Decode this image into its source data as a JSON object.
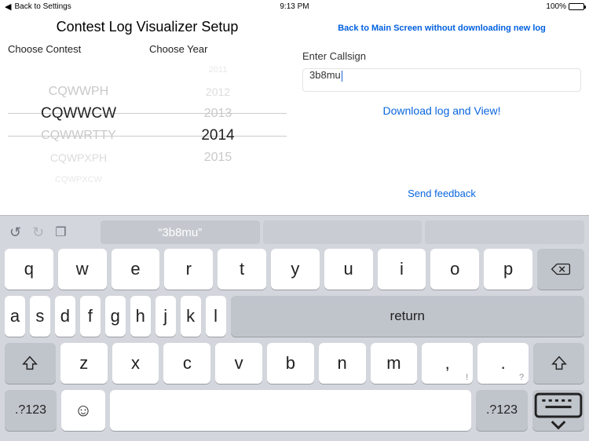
{
  "status": {
    "back": "Back to Settings",
    "time": "9:13 PM",
    "battery": "100%"
  },
  "title": "Contest Log Visualizer Setup",
  "left": {
    "contest_header": "Choose Contest",
    "year_header": "Choose Year",
    "contests": {
      "m1": "CQWWPH",
      "sel": "CQWWCW",
      "p1": "CQWWRTTY",
      "p2": "CQWPXPH",
      "p3": "CQWPXCW"
    },
    "years": {
      "m3": "2011",
      "m2": "2012",
      "m1": "2013",
      "sel": "2014",
      "p1": "2015"
    }
  },
  "right": {
    "back_link": "Back to Main Screen without downloading new log",
    "field_label": "Enter Callsign",
    "field_value": "3b8mu",
    "download": "Download log and View!",
    "feedback": "Send feedback"
  },
  "kbd": {
    "suggestion": "“3b8mu”",
    "row1": [
      "q",
      "w",
      "e",
      "r",
      "t",
      "y",
      "u",
      "i",
      "o",
      "p"
    ],
    "row2": [
      "a",
      "s",
      "d",
      "f",
      "g",
      "h",
      "j",
      "k",
      "l"
    ],
    "row3": [
      "z",
      "x",
      "c",
      "v",
      "b",
      "n",
      "m"
    ],
    "comma": ",",
    "comma_sub": "!",
    "period": ".",
    "period_sub": "?",
    "return": "return",
    "numkey": ".?123"
  }
}
